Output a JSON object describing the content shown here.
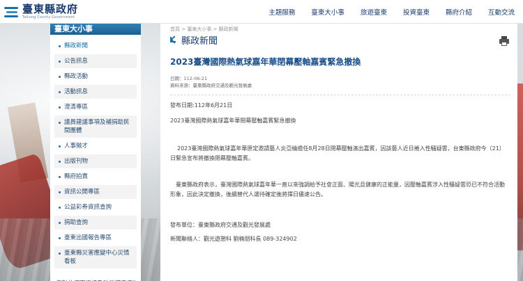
{
  "header": {
    "logo_title": "臺東縣政府",
    "logo_subtitle": "Taitung County Government",
    "nav": [
      "主題服務",
      "臺東大小事",
      "旅遊臺東",
      "投資臺東",
      "縣府介紹",
      "互動交流"
    ]
  },
  "sidebar": {
    "title": "臺東大小事",
    "items": [
      {
        "label": "縣政新聞",
        "active": true
      },
      {
        "label": "公告訊息"
      },
      {
        "label": "縣政活動"
      },
      {
        "label": "活動訊息"
      },
      {
        "label": "澄清專區"
      },
      {
        "label": "議員建議事項及補捐助民間團體"
      },
      {
        "label": "人事徵才"
      },
      {
        "label": "出版刊物"
      },
      {
        "label": "縣府拍賣"
      },
      {
        "label": "資訊公開專區"
      },
      {
        "label": "公益彩券資訊查詢"
      },
      {
        "label": "捐助查詢"
      },
      {
        "label": "臺東出國報告專區"
      },
      {
        "label": "臺東縣災害應變中心災情看板"
      }
    ],
    "footer": "您對此網頁資訊及功能滿意度?"
  },
  "content": {
    "breadcrumb": "首頁 > 臺東大小事 > 縣政新聞",
    "page_title": "縣政新聞",
    "article_title": "2023臺灣國際熱氣球嘉年華閉幕壓軸嘉賓緊急撤換",
    "date_meta": "日期：112-06-21",
    "source_meta": "資料來源：臺東縣政府交通及觀光發展處",
    "publish_date": "發布日期:112年6月21日",
    "subtitle": "2023臺灣國際熱氣球嘉年華閉幕壓軸嘉賓緊急撤換",
    "paragraph1": "2023臺灣國際熱氣球嘉年華原定邀請藝人炎亞綸擔任8月28日閉幕壓軸演出嘉賓，因該藝人近日捲入性騷疑雲，台東縣政府今（21）日緊急宣布將撤換閉幕壓軸嘉賓。",
    "paragraph2": "臺東縣政府表示，臺灣國際熱氣球嘉年華一直以來強調給予社會正面、陽光且健康的正能量，因壓軸嘉賓涉入性騷疑雲恐已不符合活動形象，因此決定撤換，後續替代人選待確定後將擇日儘速公告。",
    "unit": "發布單位：臺東縣政府交通及觀光發展處",
    "contact": "新聞聯絡人：觀光遊憩科 劉楠朋科長 089-324902"
  }
}
